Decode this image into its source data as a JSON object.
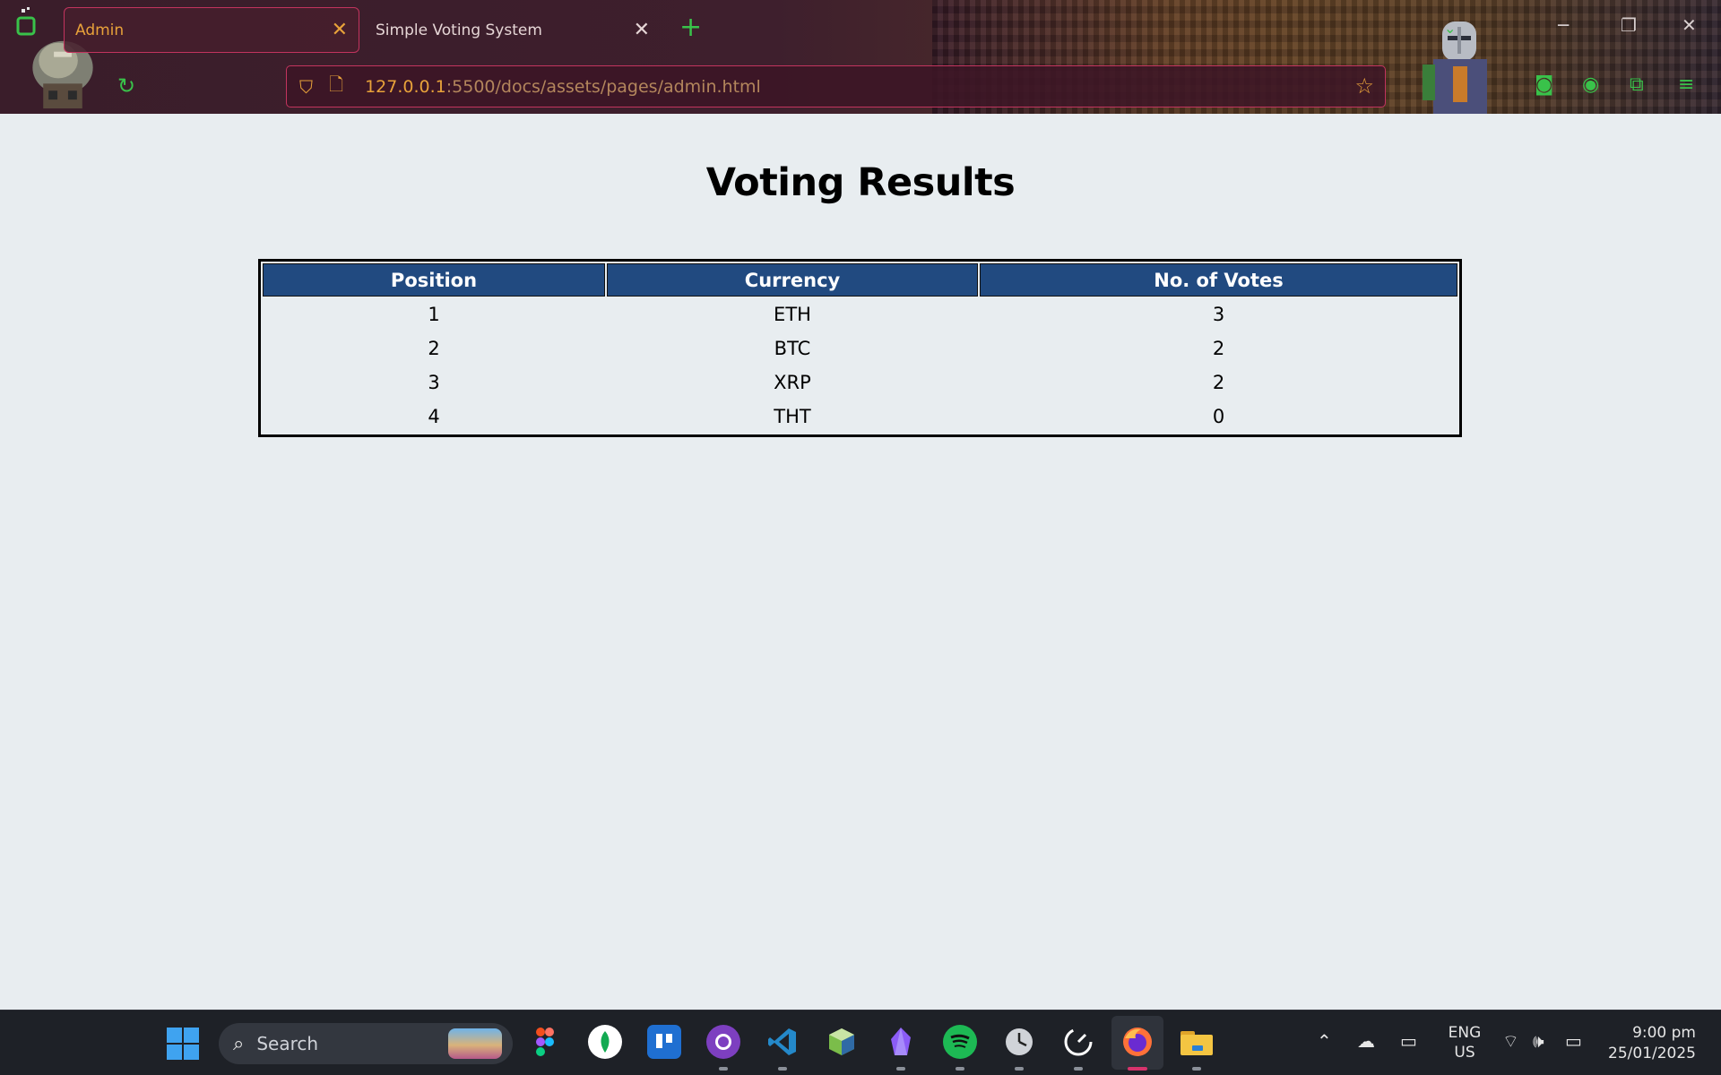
{
  "browser": {
    "tabs": [
      {
        "label": "Admin",
        "active": true
      },
      {
        "label": "Simple Voting System",
        "active": false
      }
    ],
    "new_tab_glyph": "+",
    "close_glyph": "✕",
    "url_host": "127.0.0.1",
    "url_path": ":5500/docs/assets/pages/admin.html",
    "accent_color": "#e8a23a",
    "border_color": "#c2345e",
    "icon_color": "#39c24a"
  },
  "page": {
    "title": "Voting Results",
    "table": {
      "headers": [
        "Position",
        "Currency",
        "No. of Votes"
      ],
      "rows": [
        {
          "position": "1",
          "currency": "ETH",
          "votes": "3"
        },
        {
          "position": "2",
          "currency": "BTC",
          "votes": "2"
        },
        {
          "position": "3",
          "currency": "XRP",
          "votes": "2"
        },
        {
          "position": "4",
          "currency": "THT",
          "votes": "0"
        }
      ],
      "header_bg": "#214a80"
    }
  },
  "taskbar": {
    "search_label": "Search",
    "apps": [
      "figma-icon",
      "mongodb-icon",
      "trello-icon",
      "github-desktop-icon",
      "vscode-icon",
      "virtualbox-icon",
      "obsidian-icon",
      "spotify-icon",
      "clock-app-icon",
      "speedometer-icon",
      "firefox-icon",
      "file-explorer-icon"
    ],
    "language_line1": "ENG",
    "language_line2": "US",
    "time": "9:00 pm",
    "date": "25/01/2025"
  }
}
